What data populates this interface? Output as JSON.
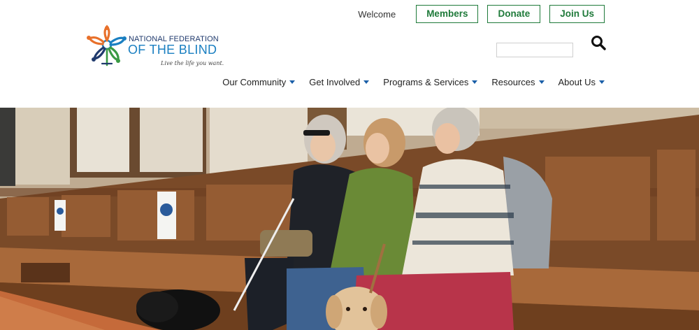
{
  "header": {
    "welcome": "Welcome",
    "buttons": {
      "members": "Members",
      "donate": "Donate",
      "join": "Join Us"
    },
    "logo": {
      "line1": "NATIONAL FEDERATION",
      "line2": "OF THE BLIND",
      "tagline": "Live the life you want."
    },
    "search": {
      "placeholder": "",
      "icon": "search-icon"
    }
  },
  "nav": {
    "items": [
      {
        "label": "Our Community"
      },
      {
        "label": "Get Involved"
      },
      {
        "label": "Programs & Services"
      },
      {
        "label": "Resources"
      },
      {
        "label": "About Us"
      }
    ]
  },
  "colors": {
    "accent_green": "#1f7a3a",
    "logo_blue": "#1a7fc1",
    "logo_navy": "#203a6d",
    "caret_blue": "#1a5fa8"
  }
}
